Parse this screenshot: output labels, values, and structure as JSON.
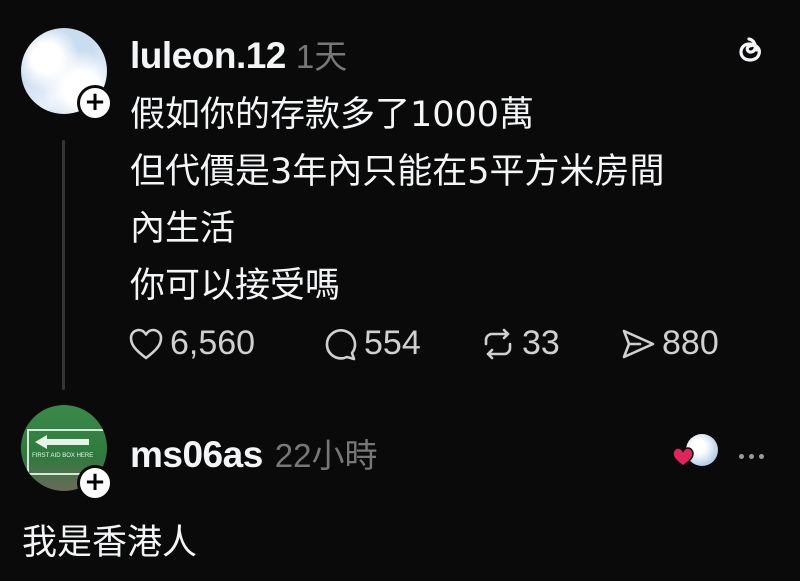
{
  "post": {
    "username": "luleon.12",
    "time": "1天",
    "lines": [
      "假如你的存款多了1000萬",
      "但代價是3年內只能在5平方米房間",
      "內生活",
      "你可以接受嗎"
    ],
    "stats": {
      "likes": "6,560",
      "comments": "554",
      "reposts": "33",
      "shares": "880"
    }
  },
  "reply": {
    "username": "ms06as",
    "time": "22小時",
    "text": "我是香港人",
    "avatar_sign_text": "FIRST AID BOX HERE"
  },
  "icons": {
    "app_logo": "threads-logo-icon",
    "like": "heart-icon",
    "comment": "comment-bubble-icon",
    "repost": "repost-icon",
    "share": "send-icon",
    "more": "more-dots-icon",
    "follow": "plus-icon"
  },
  "colors": {
    "background": "#0a0a0a",
    "text_primary": "#f3f5f7",
    "text_secondary": "#777777",
    "liked_heart": "#e0245e"
  }
}
